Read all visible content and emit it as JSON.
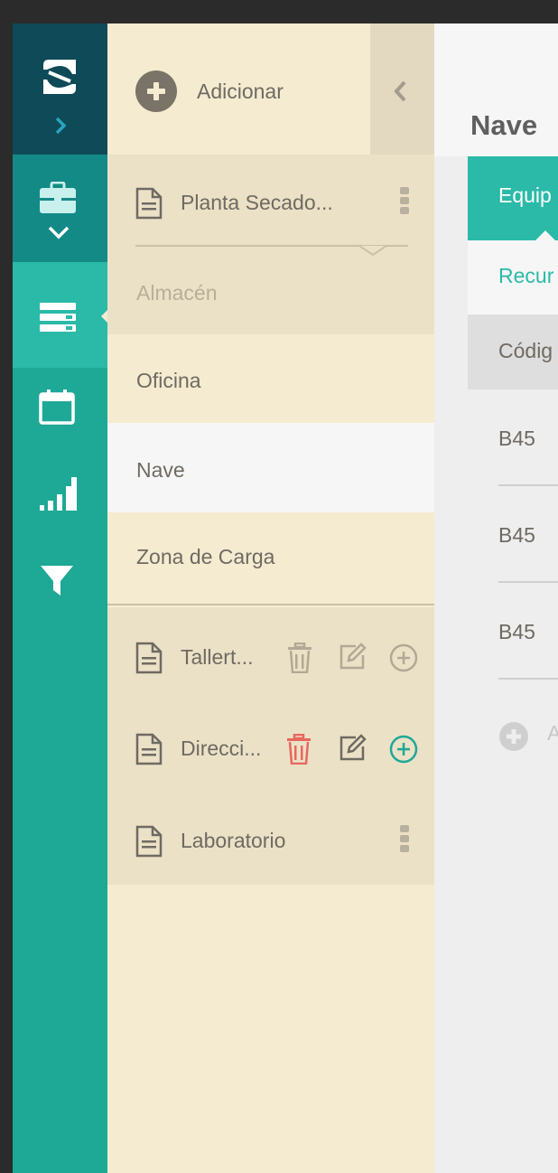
{
  "sidebar": {
    "add_label": "Adicionar",
    "tree": {
      "group1": {
        "title": "Planta Secado...",
        "sub_disabled": "Almacén"
      },
      "areas": [
        "Oficina",
        "Nave",
        "Zona de Carga"
      ],
      "selected_area": "Nave",
      "group2": [
        {
          "title": "Tallert...",
          "actions": "trash-edit-add"
        },
        {
          "title": "Direcci...",
          "actions": "trash-edit-add-colored"
        },
        {
          "title": "Laboratorio",
          "actions": "kebab"
        }
      ]
    }
  },
  "main": {
    "title": "Nave",
    "tabs": [
      "Equip",
      "Recur"
    ],
    "active_tab": "Equip",
    "table": {
      "header": "Códig",
      "rows": [
        "B45",
        "B45",
        "B45"
      ],
      "add_label": "A"
    }
  },
  "colors": {
    "rail": "#1ea896",
    "rail_logo": "#0e4a57",
    "accent": "#2bbaa8",
    "panel": "#f5ebd0",
    "panel_group": "#ebe1c6",
    "danger": "#e8675e"
  },
  "icons": [
    "logo-icon",
    "chevron-right-icon",
    "briefcase-icon",
    "chevron-down-icon",
    "list-icon",
    "calendar-icon",
    "signal-icon",
    "filter-icon",
    "document-icon",
    "trash-icon",
    "edit-icon",
    "add-circle-icon",
    "kebab-icon"
  ]
}
